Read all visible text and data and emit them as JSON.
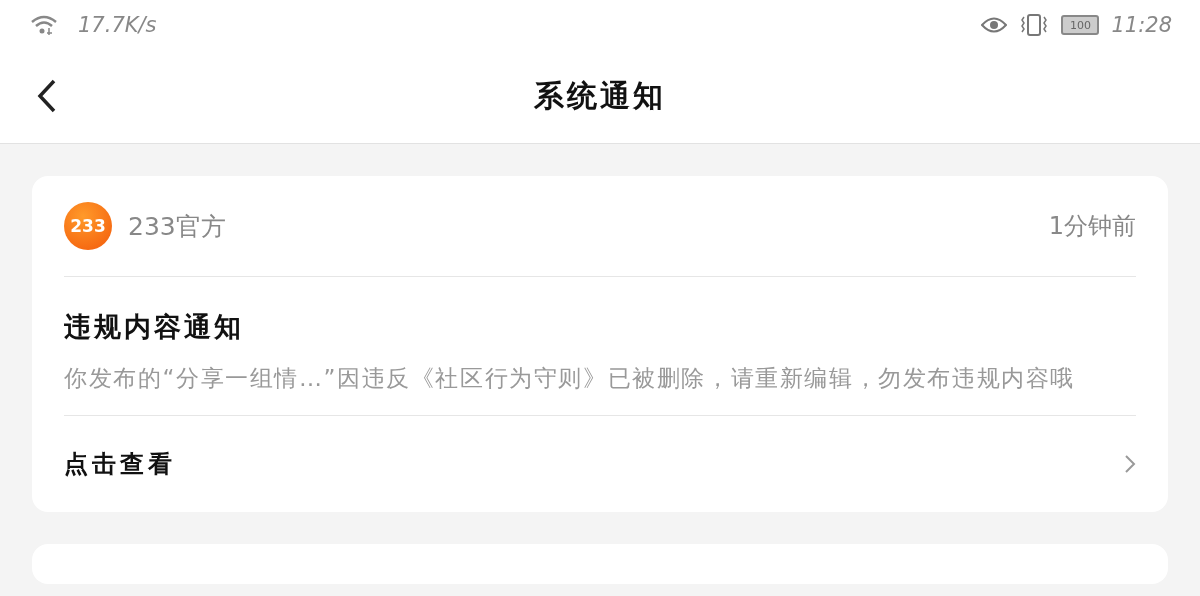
{
  "status_bar": {
    "speed": "17.7K/s",
    "battery": "100",
    "time": "11:28"
  },
  "header": {
    "title": "系统通知"
  },
  "notifications": [
    {
      "sender": "233官方",
      "avatar_text": "233",
      "time": "1分钟前",
      "title": "违规内容通知",
      "body": "你发布的“分享一组情…”因违反《社区行为守则》已被删除，请重新编辑，勿发布违规内容哦",
      "action": "点击查看"
    }
  ]
}
